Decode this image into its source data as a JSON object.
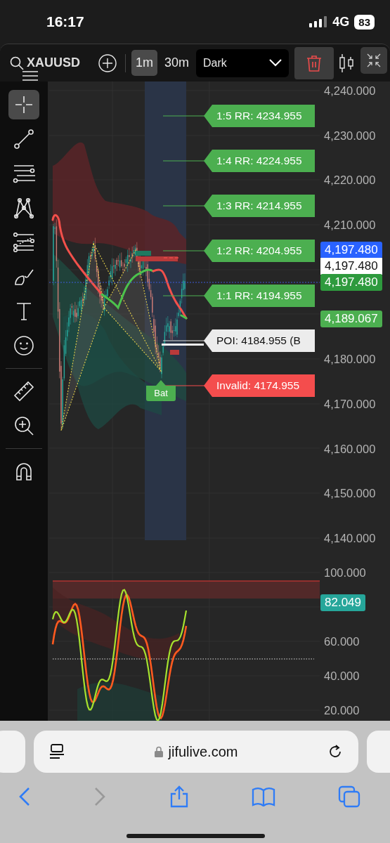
{
  "status_bar": {
    "time": "16:17",
    "network": "4G",
    "battery": "83"
  },
  "toolbar": {
    "symbol": "XAUUSD",
    "intervals": [
      {
        "label": "1m",
        "selected": true
      },
      {
        "label": "30m",
        "selected": false
      }
    ],
    "theme": "Dark"
  },
  "drawing_tools": [
    {
      "kind": "crosshair",
      "selected": true
    },
    {
      "kind": "trendline",
      "selected": false
    },
    {
      "kind": "lines",
      "selected": false
    },
    {
      "kind": "pattern",
      "selected": false
    },
    {
      "kind": "fib",
      "selected": false
    },
    {
      "kind": "brush",
      "selected": false
    },
    {
      "kind": "text",
      "selected": false
    },
    {
      "kind": "emoji",
      "selected": false
    },
    {
      "kind": "ruler",
      "selected": false
    },
    {
      "kind": "zoom",
      "selected": false
    },
    {
      "kind": "magnet",
      "selected": false
    }
  ],
  "price_axis": {
    "ticks": [
      {
        "label": "4,240.000",
        "kind": "tick"
      },
      {
        "label": "4,230.000",
        "kind": "tick"
      },
      {
        "label": "4,220.000",
        "kind": "tick"
      },
      {
        "label": "4,210.000",
        "kind": "tick"
      },
      {
        "kind": "gap"
      },
      {
        "label": "4,189.067",
        "kind": "tag",
        "color": "#4caf50"
      },
      {
        "label": "4,180.000",
        "kind": "tick"
      },
      {
        "label": "4,170.000",
        "kind": "tick"
      },
      {
        "label": "4,160.000",
        "kind": "tick"
      },
      {
        "label": "4,150.000",
        "kind": "tick"
      },
      {
        "label": "4,140.000",
        "kind": "tick"
      }
    ],
    "tags": [
      {
        "label": "4,197.480",
        "color": "#2962ff"
      },
      {
        "label": "4,197.480",
        "color": "#ffffff"
      },
      {
        "label": "4,197.480",
        "color": "#2e9a3e"
      }
    ]
  },
  "levels": [
    {
      "text": "1:5 RR: 4234.955",
      "kind": "target"
    },
    {
      "text": "1:4 RR: 4224.955",
      "kind": "target"
    },
    {
      "text": "1:3 RR: 4214.955",
      "kind": "target"
    },
    {
      "text": "1:2 RR: 4204.955",
      "kind": "target"
    },
    {
      "text": "1:1 RR: 4194.955",
      "kind": "target"
    },
    {
      "text": "POI: 4184.955 (B",
      "kind": "poi"
    },
    {
      "text": "Invalid: 4174.955",
      "kind": "invalid"
    }
  ],
  "pattern_label": "Bat",
  "oscillator_axis": [
    {
      "label": "100.000",
      "kind": "tick"
    },
    {
      "label": "82.049",
      "kind": "tag",
      "color": "#26a69a"
    },
    {
      "label": "60.000",
      "kind": "tick"
    },
    {
      "label": "40.000",
      "kind": "tick"
    },
    {
      "label": "20.000",
      "kind": "tick"
    }
  ],
  "browser": {
    "url": "jifulive.com"
  }
}
